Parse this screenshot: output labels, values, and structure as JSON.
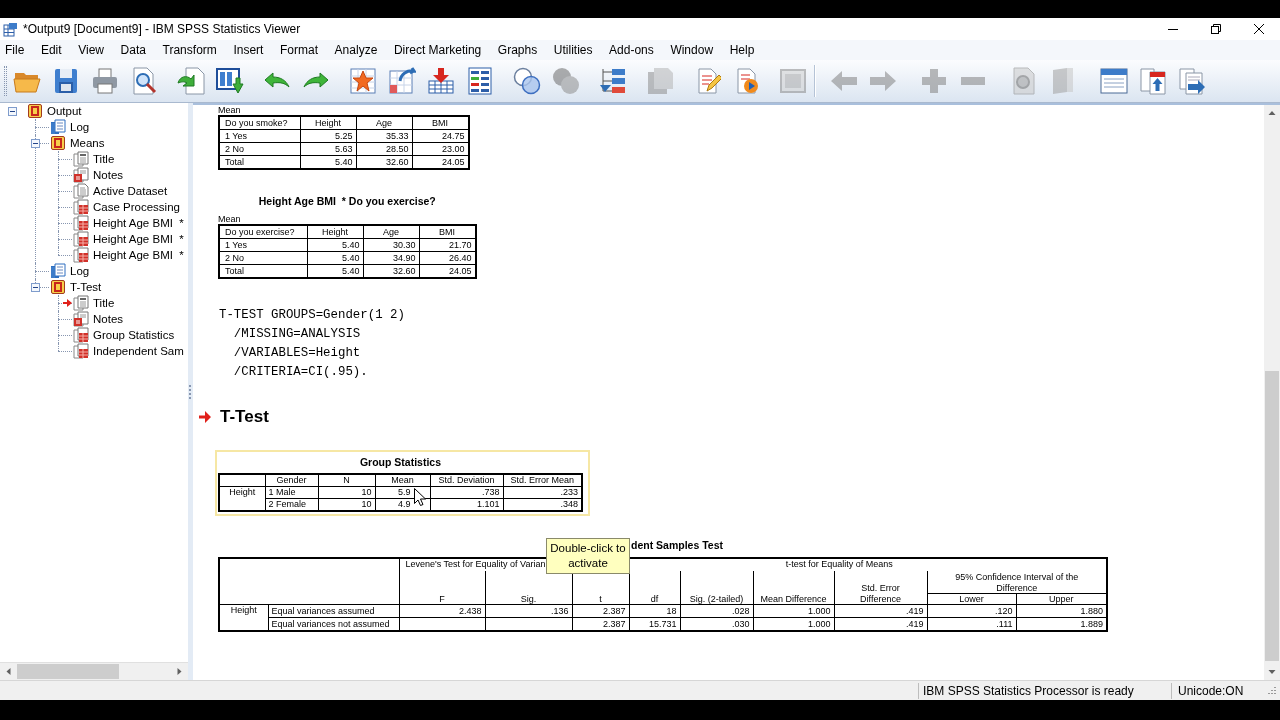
{
  "window": {
    "title": "*Output9 [Document9] - IBM SPSS Statistics Viewer"
  },
  "menu": [
    "File",
    "Edit",
    "View",
    "Data",
    "Transform",
    "Insert",
    "Format",
    "Analyze",
    "Direct Marketing",
    "Graphs",
    "Utilities",
    "Add-ons",
    "Window",
    "Help"
  ],
  "toolbar": {
    "groups": [
      {
        "buttons": [
          {
            "disabled": false
          },
          {
            "disabled": false
          },
          {
            "disabled": false
          },
          {
            "disabled": false
          },
          {
            "disabled": false
          },
          {
            "disabled": false
          },
          {
            "disabled": false
          },
          {
            "disabled": false
          },
          {
            "disabled": false
          },
          {
            "disabled": false
          },
          {
            "disabled": false
          },
          {
            "disabled": false
          },
          {
            "disabled": false
          },
          {
            "disabled": true
          },
          {
            "disabled": false
          },
          {
            "disabled": true
          },
          {
            "disabled": false
          },
          {
            "disabled": false
          },
          {
            "disabled": true
          }
        ]
      },
      {
        "buttons": [
          {
            "disabled": true
          },
          {
            "disabled": true
          },
          {
            "disabled": true
          },
          {
            "disabled": true
          },
          {
            "disabled": true
          },
          {
            "disabled": true
          },
          {
            "disabled": false
          },
          {
            "disabled": false
          },
          {
            "disabled": false
          }
        ]
      }
    ]
  },
  "outline": {
    "items": [
      {
        "label": "Output",
        "kind": "heading",
        "current": false,
        "expanded": true,
        "children": [
          {
            "label": "Log",
            "kind": "log",
            "current": false
          },
          {
            "label": "Means",
            "kind": "heading",
            "current": false,
            "expanded": true,
            "children": [
              {
                "label": "Title",
                "kind": "title",
                "current": false
              },
              {
                "label": "Notes",
                "kind": "notes",
                "current": false
              },
              {
                "label": "Active Dataset",
                "kind": "text",
                "current": false
              },
              {
                "label": "Case Processing",
                "kind": "table",
                "current": false
              },
              {
                "label": "Height Age BMI  *",
                "kind": "table",
                "current": false
              },
              {
                "label": "Height Age BMI  *",
                "kind": "table",
                "current": false
              },
              {
                "label": "Height Age BMI  *",
                "kind": "table",
                "current": false
              }
            ]
          },
          {
            "label": "Log",
            "kind": "log",
            "current": false
          },
          {
            "label": "T-Test",
            "kind": "heading",
            "current": false,
            "expanded": true,
            "children": [
              {
                "label": "Title",
                "kind": "title",
                "current": true
              },
              {
                "label": "Notes",
                "kind": "notes",
                "current": false
              },
              {
                "label": "Group Statistics",
                "kind": "table",
                "current": false
              },
              {
                "label": "Independent Sam",
                "kind": "table",
                "current": false
              }
            ]
          }
        ]
      }
    ]
  },
  "viewer": {
    "means_tables": [
      {
        "caption": "Mean",
        "columns": [
          "Do you smoke?",
          "Height",
          "Age",
          "BMI"
        ],
        "rows": [
          [
            "1 Yes",
            "5.25",
            "35.33",
            "24.75"
          ],
          [
            "2 No",
            "5.63",
            "28.50",
            "23.00"
          ],
          [
            "Total",
            "5.40",
            "32.60",
            "24.05"
          ]
        ]
      },
      {
        "title": "Height Age BMI  * Do you exercise?",
        "caption": "Mean",
        "columns": [
          "Do you exercise?",
          "Height",
          "Age",
          "BMI"
        ],
        "rows": [
          [
            "1 Yes",
            "5.40",
            "30.30",
            "21.70"
          ],
          [
            "2 No",
            "5.40",
            "34.90",
            "26.40"
          ],
          [
            "Total",
            "5.40",
            "32.60",
            "24.05"
          ]
        ]
      }
    ],
    "syntax": [
      "T-TEST GROUPS=Gender(1 2)",
      "  /MISSING=ANALYSIS",
      "  /VARIABLES=Height",
      "  /CRITERIA=CI(.95)."
    ],
    "heading": {
      "text": "T-Test",
      "current": true
    },
    "group_statistics": {
      "title": "Group Statistics",
      "highlighted": true,
      "columns": [
        "Gender",
        "N",
        "Mean",
        "Std. Deviation",
        "Std. Error Mean"
      ],
      "rows": [
        {
          "variable": "Height",
          "values": [
            "1 Male",
            "10",
            "5.9",
            ".738",
            ".233"
          ]
        },
        {
          "values": [
            "2 Female",
            "10",
            "4.9",
            "1.101",
            ".348"
          ]
        }
      ]
    },
    "independent_samples_test": {
      "title": "dent Samples Test",
      "group_headers": [
        "Levene's Test for Equality of Varian",
        "t-test for Equality of Means"
      ],
      "levene_columns": [
        "F",
        "Sig."
      ],
      "t_test_columns": [
        "t",
        "df",
        "Sig. (2-tailed)",
        "Mean Difference",
        "Std. Error Difference"
      ],
      "interval_header": "95% Confidence Interval of the Difference",
      "interval_columns": [
        "Lower",
        "Upper"
      ],
      "rows": [
        {
          "variable": "Height",
          "assumption": "Equal variances assumed",
          "levene": [
            "2.438",
            ".136"
          ],
          "t_test": [
            "2.387",
            "18",
            ".028",
            "1.000",
            ".419",
            ".120",
            "1.880"
          ]
        },
        {
          "assumption": "Equal variances not assumed",
          "t_test": [
            "2.387",
            "15.731",
            ".030",
            "1.000",
            ".419",
            ".111",
            "1.889"
          ]
        }
      ]
    },
    "tooltip": "Double-click to activate"
  },
  "status_bar": {
    "message": "IBM SPSS Statistics Processor is ready",
    "encoding": "Unicode:ON"
  }
}
